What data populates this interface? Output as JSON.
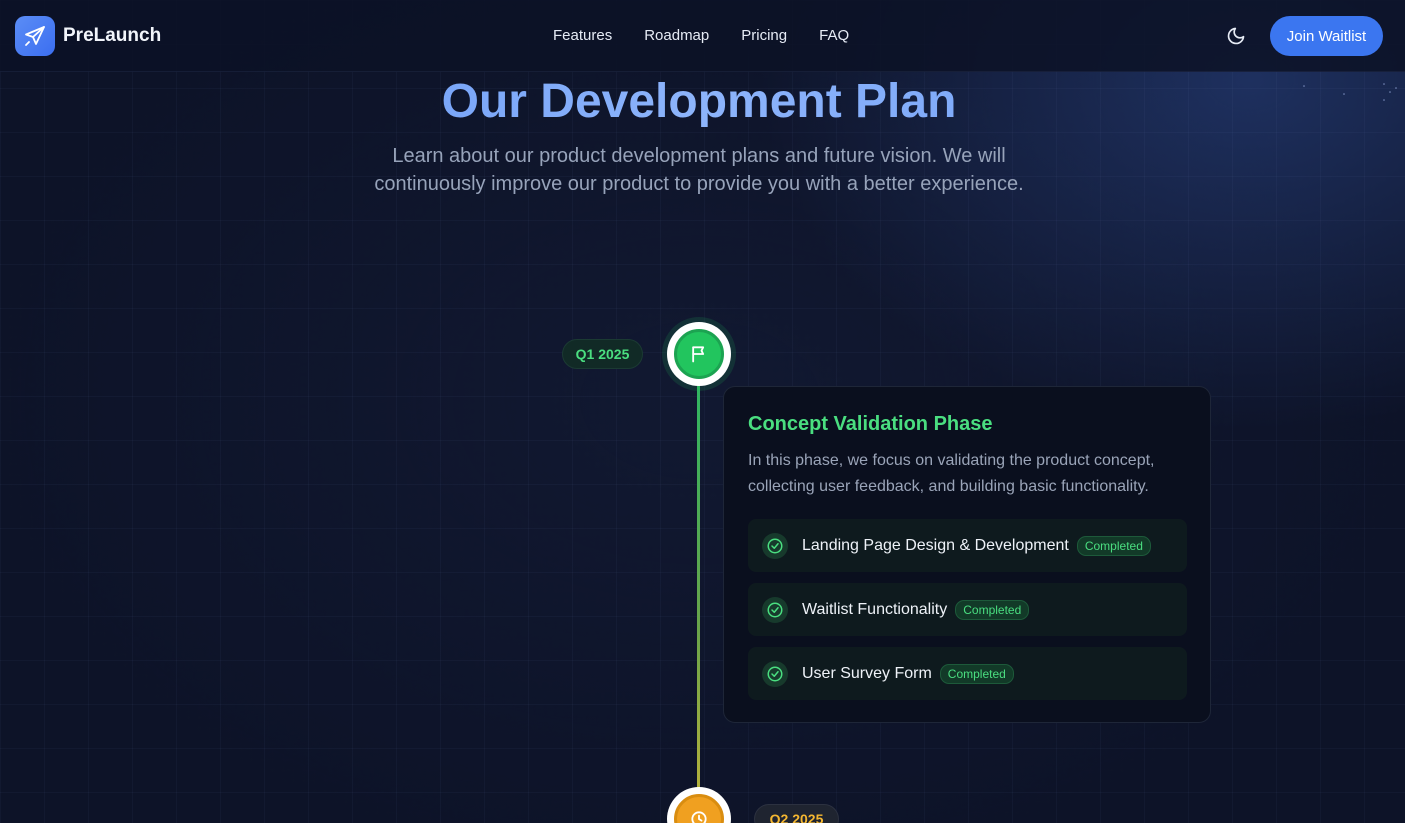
{
  "brand": {
    "name": "PreLaunch",
    "logo_icon": "paper-plane-icon",
    "accent": "#3b76f0"
  },
  "nav": {
    "items": [
      "Features",
      "Roadmap",
      "Pricing",
      "FAQ"
    ]
  },
  "header": {
    "theme_icon": "moon-icon",
    "cta_label": "Join Waitlist"
  },
  "hero": {
    "title": "Our Development Plan",
    "subtitle": "Learn about our product development plans and future vision. We will continuously improve our product to provide you with a better experience."
  },
  "timeline": [
    {
      "quarter": "Q1 2025",
      "icon": "flag-icon",
      "status_color": "#22c55e",
      "title": "Concept Validation Phase",
      "description": "In this phase, we focus on validating the product concept, collecting user feedback, and building basic functionality.",
      "tasks": [
        {
          "label": "Landing Page Design & Development",
          "status": "Completed",
          "icon": "check-circle-icon"
        },
        {
          "label": "Waitlist Functionality",
          "status": "Completed",
          "icon": "check-circle-icon"
        },
        {
          "label": "User Survey Form",
          "status": "Completed",
          "icon": "check-circle-icon"
        }
      ]
    },
    {
      "quarter": "Q2 2025",
      "icon": "clock-icon",
      "status_color": "#f0a020"
    }
  ]
}
